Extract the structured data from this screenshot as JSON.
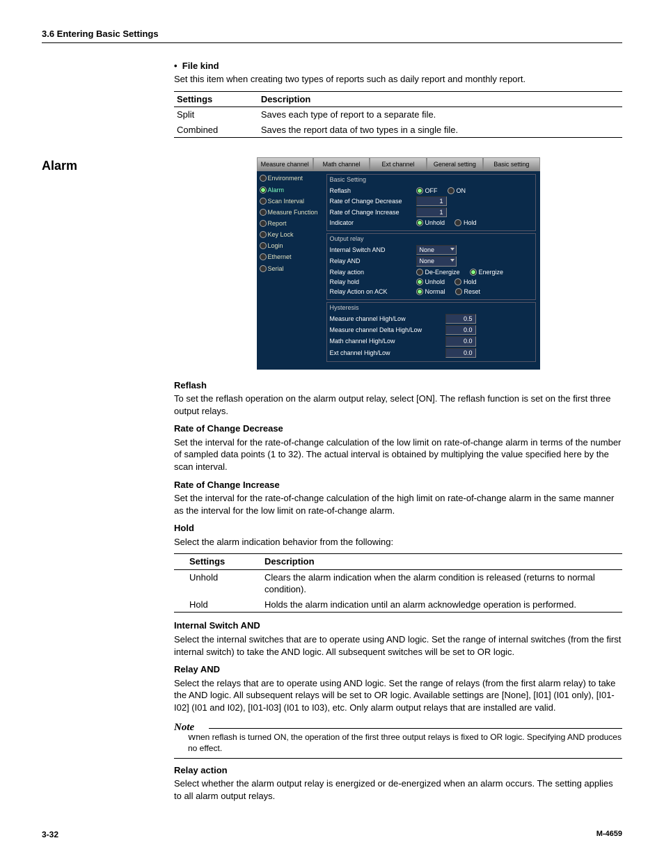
{
  "header": "3.6  Entering Basic Settings",
  "filekind": {
    "title": "File kind",
    "desc": "Set this item when creating two types of reports such as daily report and monthly report.",
    "th1": "Settings",
    "th2": "Description",
    "rows": [
      {
        "s": "Split",
        "d": "Saves each type of report to a separate file."
      },
      {
        "s": "Combined",
        "d": "Saves the report data of two types in a single file."
      }
    ]
  },
  "alarm_heading": "Alarm",
  "app": {
    "tabs": [
      "Measure channel",
      "Math channel",
      "Ext channel",
      "General setting",
      "Basic setting"
    ],
    "side": [
      "Environment",
      "Alarm",
      "Scan Interval",
      "Measure Function",
      "Report",
      "Key Lock",
      "Login",
      "Ethernet",
      "Serial"
    ],
    "side_active_index": 1,
    "group_basic": {
      "title": "Basic Setting",
      "reflash": "Reflash",
      "off": "OFF",
      "on": "ON",
      "roc_dec": "Rate of Change Decrease",
      "roc_dec_v": "1",
      "roc_inc": "Rate of Change Increase",
      "roc_inc_v": "1",
      "indicator": "Indicator",
      "unhold": "Unhold",
      "hold": "Hold"
    },
    "group_relay": {
      "title": "Output relay",
      "isw": "Internal Switch AND",
      "isw_v": "None",
      "rand": "Relay AND",
      "rand_v": "None",
      "raction": "Relay action",
      "de": "De-Energize",
      "en": "Energize",
      "rhold": "Relay hold",
      "unhold": "Unhold",
      "hold": "Hold",
      "rack": "Relay Action on ACK",
      "normal": "Normal",
      "reset": "Reset"
    },
    "group_hys": {
      "title": "Hysteresis",
      "r1": "Measure channel High/Low",
      "v1": "0.5",
      "r2": "Measure channel Delta High/Low",
      "v2": "0.0",
      "r3": "Math channel High/Low",
      "v3": "0.0",
      "r4": "Ext channel High/Low",
      "v4": "0.0"
    }
  },
  "reflash": {
    "h": "Reflash",
    "p": "To set the reflash operation on the alarm output relay, select [ON].  The reflash function is set on the first three output relays."
  },
  "rocd": {
    "h": "Rate of Change Decrease",
    "p": "Set the interval for the rate-of-change calculation of the low limit on rate-of-change alarm in terms of the number of sampled data points (1 to 32).  The actual interval is obtained by multiplying the value specified here by the scan interval."
  },
  "roci": {
    "h": "Rate of Change Increase",
    "p": "Set the interval for the rate-of-change calculation of the high limit on rate-of-change alarm in the same manner as the interval for the low limit on rate-of-change alarm."
  },
  "hold": {
    "h": "Hold",
    "p": "Select the alarm indication behavior from the following:",
    "th1": "Settings",
    "th2": "Description",
    "rows": [
      {
        "s": "Unhold",
        "d": "Clears the alarm indication when the alarm condition is released (returns to normal condition)."
      },
      {
        "s": "Hold",
        "d": "Holds the alarm indication until an alarm acknowledge operation is performed."
      }
    ]
  },
  "isw": {
    "h": "Internal Switch AND",
    "p": "Select the internal switches that are to operate using AND logic.  Set the range of internal switches (from the first internal switch) to take the AND logic.  All subsequent switches will be set to OR logic."
  },
  "rand": {
    "h": "Relay AND",
    "p": "Select the relays that are to operate using AND logic.  Set the range of relays (from the first alarm relay) to take the AND logic.  All subsequent relays will be set to OR logic.  Available settings are [None], [I01] (I01 only), [I01-I02] (I01 and I02), [I01-I03] (I01 to I03), etc.  Only alarm output relays that are installed are valid."
  },
  "note": {
    "h": "Note",
    "p": "When reflash is turned ON, the operation of the first three output relays is fixed to OR logic.  Specifying AND produces no effect."
  },
  "raction": {
    "h": "Relay action",
    "p": "Select whether the alarm output relay is energized or de-energized when an alarm occurs.  The setting applies to all alarm output relays."
  },
  "footer": {
    "page": "3-32",
    "doc": "M-4659"
  }
}
